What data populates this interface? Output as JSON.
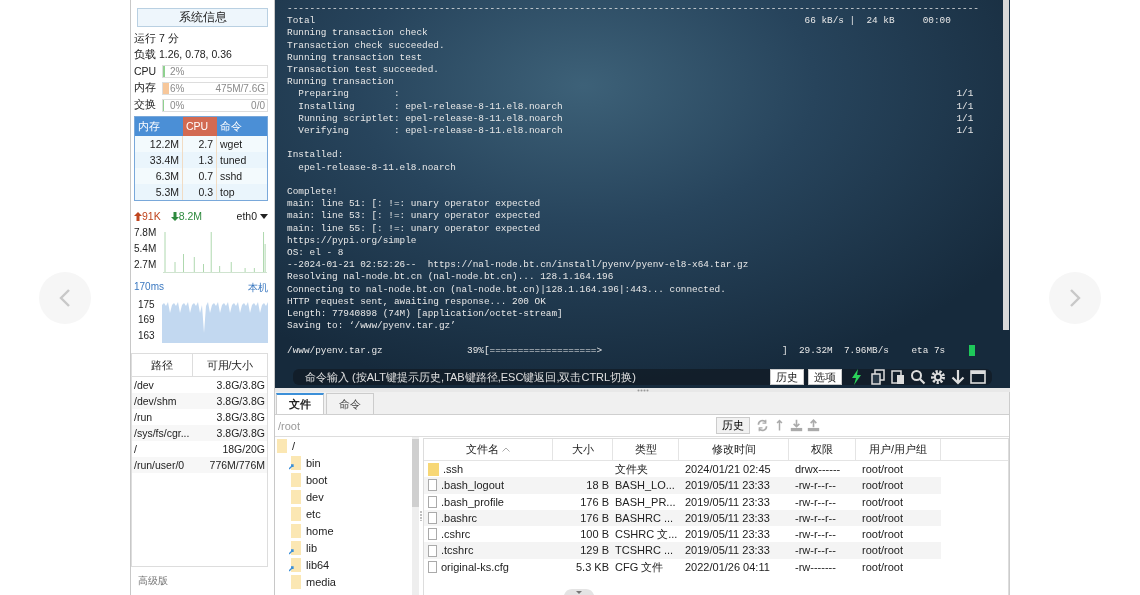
{
  "sidebar": {
    "title": "系统信息",
    "uptime": "运行 7 分",
    "load": "负载 1.26, 0.78, 0.36",
    "meters": [
      {
        "label": "CPU",
        "percent": "2%",
        "level": 0.02,
        "color": "#8fd18f"
      },
      {
        "label": "内存",
        "percent": "6%",
        "detail": "475M/7.6G",
        "level": 0.06,
        "color": "#f7c79a"
      },
      {
        "label": "交换",
        "percent": "0%",
        "detail": "0/0",
        "level": 0,
        "color": "#8fd18f"
      }
    ],
    "processes": {
      "columns": [
        {
          "label": "内存",
          "selected": false
        },
        {
          "label": "CPU",
          "selected": true
        },
        {
          "label": "命令",
          "selected": false
        }
      ],
      "rows": [
        {
          "memory": "12.2M",
          "cpu": "2.7",
          "command": "wget"
        },
        {
          "memory": "33.4M",
          "cpu": "1.3",
          "command": "tuned"
        },
        {
          "memory": "6.3M",
          "cpu": "0.7",
          "command": "sshd"
        },
        {
          "memory": "5.3M",
          "cpu": "0.3",
          "command": "top"
        }
      ]
    },
    "network": {
      "upload": "91K",
      "download": "8.2M",
      "interface": "eth0",
      "yticks": [
        "7.8M",
        "5.4M",
        "2.7M"
      ]
    },
    "latency": {
      "value": "170ms",
      "host": "本机",
      "yticks": [
        "175",
        "169",
        "163"
      ]
    },
    "disks": {
      "columns": [
        "路径",
        "可用/大小"
      ],
      "rows": [
        {
          "path": "/dev",
          "usage": "3.8G/3.8G"
        },
        {
          "path": "/dev/shm",
          "usage": "3.8G/3.8G"
        },
        {
          "path": "/run",
          "usage": "3.8G/3.8G"
        },
        {
          "path": "/sys/fs/cgr...",
          "usage": "3.8G/3.8G"
        },
        {
          "path": "/",
          "usage": "18G/20G"
        },
        {
          "path": "/run/user/0",
          "usage": "776M/776M"
        }
      ]
    },
    "edition": "高级版"
  },
  "terminal": {
    "blocks": [
      [
        "---------------------------------------------------------------------------------------------------------------------------",
        "Total                                                                                       66 kB/s |  24 kB     00:00",
        "Running transaction check",
        "Transaction check succeeded.",
        "Running transaction test",
        "Transaction test succeeded.",
        "Running transaction",
        "  Preparing        :                                                                                                   1/1",
        "  Installing       : epel-release-8-11.el8.noarch                                                                      1/1",
        "  Running scriptlet: epel-release-8-11.el8.noarch                                                                      1/1",
        "  Verifying        : epel-release-8-11.el8.noarch                                                                      1/1"
      ],
      [
        "Installed:",
        "  epel-release-8-11.el8.noarch"
      ],
      [
        "Complete!",
        "main: line 51: [: !=: unary operator expected",
        "main: line 53: [: !=: unary operator expected",
        "main: line 55: [: !=: unary operator expected",
        "https://pypi.org/simple",
        "OS: el - 8",
        "--2024-01-21 02:52:26--  https://nal-node.bt.cn/install/pyenv/pyenv-el8-x64.tar.gz",
        "Resolving nal-node.bt.cn (nal-node.bt.cn)... 128.1.164.196",
        "Connecting to nal-node.bt.cn (nal-node.bt.cn)|128.1.164.196|:443... connected.",
        "HTTP request sent, awaiting response... 200 OK",
        "Length: 77940898 (74M) [application/octet-stream]",
        "Saving to: ‘/www/pyenv.tar.gz’"
      ],
      [
        "/www/pyenv.tar.gz               39%[===================>                                ]  29.32M  7.96MB/s    eta 7s"
      ]
    ],
    "command_bar": {
      "placeholder": "命令输入 (按ALT键提示历史,TAB键路径,ESC键返回,双击CTRL切换)",
      "buttons": [
        "历史",
        "选项"
      ]
    }
  },
  "files": {
    "tabs": [
      {
        "label": "文件",
        "selected": true
      },
      {
        "label": "命令",
        "selected": false
      }
    ],
    "path": "/root",
    "history_button": "历史",
    "tree": {
      "label": "/",
      "children": [
        {
          "label": "bin",
          "symlink": true
        },
        {
          "label": "boot",
          "symlink": false
        },
        {
          "label": "dev",
          "symlink": false
        },
        {
          "label": "etc",
          "symlink": false
        },
        {
          "label": "home",
          "symlink": false
        },
        {
          "label": "lib",
          "symlink": true
        },
        {
          "label": "lib64",
          "symlink": true
        },
        {
          "label": "media",
          "symlink": false
        }
      ]
    },
    "table": {
      "columns": [
        {
          "label": "文件名",
          "sorted": true
        },
        {
          "label": "大小",
          "sorted": false
        },
        {
          "label": "类型",
          "sorted": false
        },
        {
          "label": "修改时间",
          "sorted": false
        },
        {
          "label": "权限",
          "sorted": false
        },
        {
          "label": "用户/用户组",
          "sorted": false
        }
      ],
      "rows": [
        {
          "kind": "folder",
          "name": ".ssh",
          "type": "文件夹",
          "modified": "2024/01/21 02:45",
          "permissions": "drwx------",
          "owner": "root/root"
        },
        {
          "kind": "file",
          "name": ".bash_logout",
          "size": "18 B",
          "type": "BASH_LO...",
          "modified": "2019/05/11 23:33",
          "permissions": "-rw-r--r--",
          "owner": "root/root"
        },
        {
          "kind": "file",
          "name": ".bash_profile",
          "size": "176 B",
          "type": "BASH_PR...",
          "modified": "2019/05/11 23:33",
          "permissions": "-rw-r--r--",
          "owner": "root/root"
        },
        {
          "kind": "file",
          "name": ".bashrc",
          "size": "176 B",
          "type": "BASHRC ...",
          "modified": "2019/05/11 23:33",
          "permissions": "-rw-r--r--",
          "owner": "root/root"
        },
        {
          "kind": "file",
          "name": ".cshrc",
          "size": "100 B",
          "type": "CSHRC 文...",
          "modified": "2019/05/11 23:33",
          "permissions": "-rw-r--r--",
          "owner": "root/root"
        },
        {
          "kind": "file",
          "name": ".tcshrc",
          "size": "129 B",
          "type": "TCSHRC ...",
          "modified": "2019/05/11 23:33",
          "permissions": "-rw-r--r--",
          "owner": "root/root"
        },
        {
          "kind": "file",
          "name": "original-ks.cfg",
          "size": "5.3 KB",
          "type": "CFG 文件",
          "modified": "2022/01/26 04:11",
          "permissions": "-rw-------",
          "owner": "root/root"
        }
      ]
    }
  }
}
